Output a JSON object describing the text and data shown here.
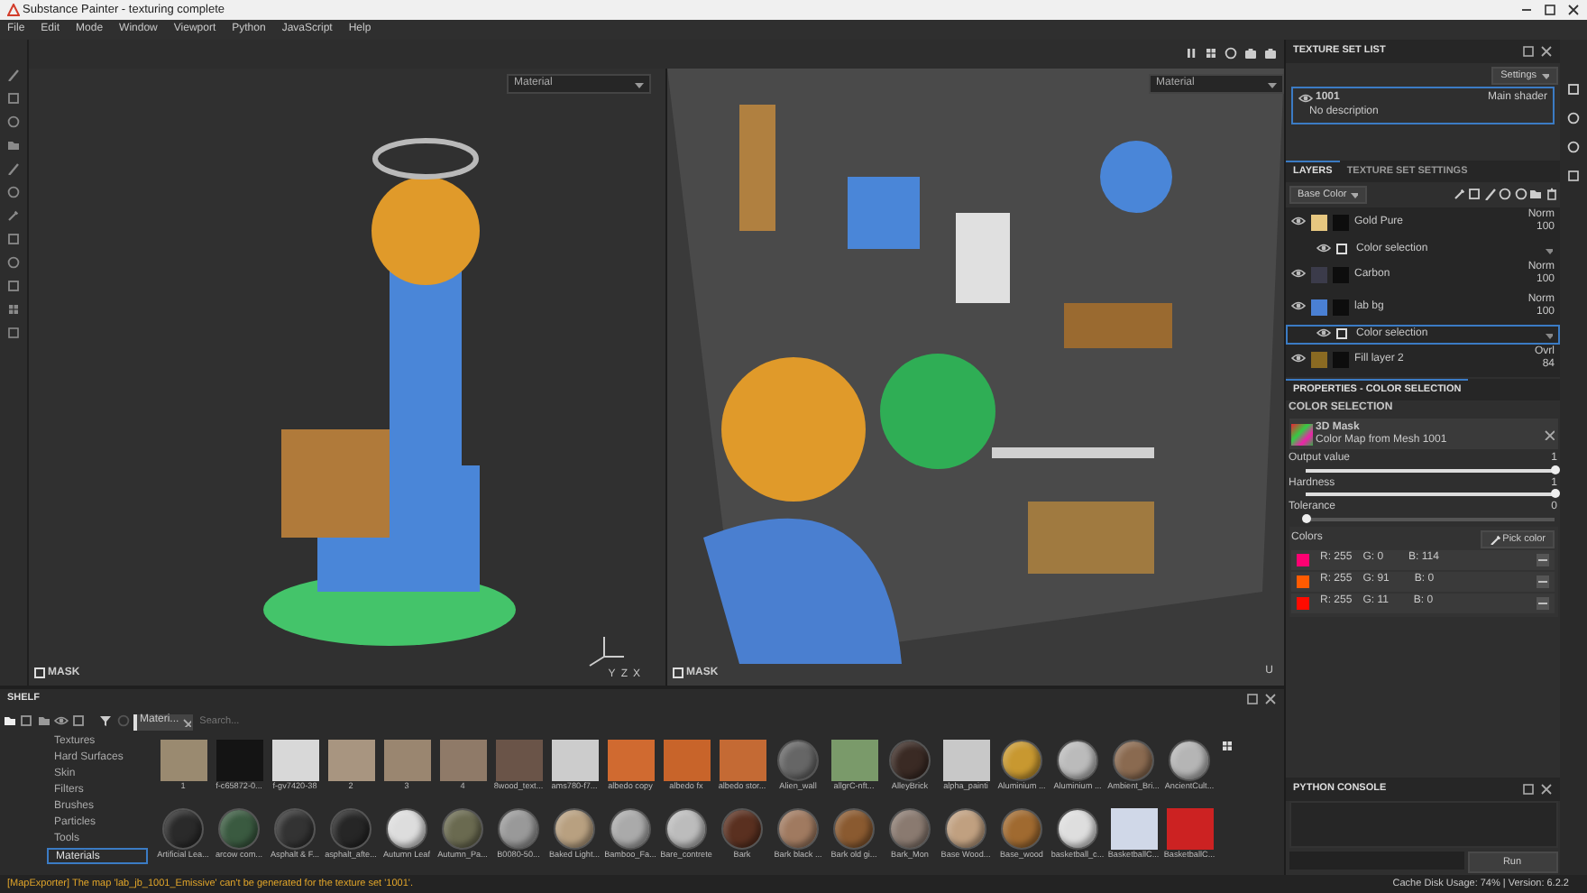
{
  "window": {
    "title": "Substance Painter - texturing complete"
  },
  "menu": [
    "File",
    "Edit",
    "Mode",
    "Window",
    "Viewport",
    "Python",
    "JavaScript",
    "Help"
  ],
  "viewport_3d": {
    "dropdown": "Material",
    "mask": {
      "label": "MASK",
      "checked": false
    },
    "axes": [
      "Y",
      "Z",
      "X"
    ]
  },
  "viewport_2d": {
    "dropdown": "Material",
    "mask": {
      "label": "MASK",
      "checked": false
    },
    "axes": [
      "U"
    ]
  },
  "texture_set_list": {
    "title": "TEXTURE SET LIST",
    "settings": "Settings",
    "items": [
      {
        "name": "1001",
        "description": "No description",
        "shader": "Main shader",
        "selected": true
      }
    ]
  },
  "layers": {
    "tabs": [
      {
        "label": "LAYERS",
        "selected": true
      },
      {
        "label": "TEXTURE SET SETTINGS",
        "selected": false
      }
    ],
    "channel": "Base Color",
    "items": [
      {
        "kind": "layer",
        "name": "Gold Pure",
        "blend": "Norm",
        "opacity": "100",
        "color": "#e6c780",
        "selected": false
      },
      {
        "kind": "effect",
        "name": "Color selection",
        "selected": false
      },
      {
        "kind": "layer",
        "name": "Carbon",
        "blend": "Norm",
        "opacity": "100",
        "color": "#3b3b4a",
        "selected": false
      },
      {
        "kind": "layer",
        "name": "lab bg",
        "blend": "Norm",
        "opacity": "100",
        "color": "#4a80d4",
        "selected": false
      },
      {
        "kind": "effect",
        "name": "Color selection",
        "selected": true
      },
      {
        "kind": "layer",
        "name": "Fill layer 2",
        "blend": "Ovrl",
        "opacity": "84",
        "color": "#8a6a22",
        "selected": false
      }
    ]
  },
  "properties": {
    "tab": "PROPERTIES - COLOR SELECTION",
    "section": "COLOR SELECTION",
    "mask": {
      "title": "3D Mask",
      "subtitle": "Color Map from Mesh 1001"
    },
    "sliders": [
      {
        "label": "Output value",
        "value": "1",
        "level": 1
      },
      {
        "label": "Hardness",
        "value": "1",
        "level": 1
      },
      {
        "label": "Tolerance",
        "value": "0",
        "level": 0
      }
    ],
    "colors_label": "Colors",
    "pick_button": "Pick color",
    "colors": [
      {
        "r": "R: 255",
        "g": "G: 0",
        "b": "B: 114",
        "color": "#ff0072"
      },
      {
        "r": "R: 255",
        "g": "G: 91",
        "b": "B: 0",
        "color": "#ff5b00"
      },
      {
        "r": "R: 255",
        "g": "G: 11",
        "b": "B: 0",
        "color": "#ff0b00"
      }
    ]
  },
  "python_console": {
    "title": "PYTHON CONSOLE",
    "run": "Run"
  },
  "shelf": {
    "title": "SHELF",
    "filter_chip": "Materi...",
    "search_placeholder": "Search...",
    "categories": [
      {
        "label": "Textures",
        "selected": false
      },
      {
        "label": "Hard Surfaces",
        "selected": false
      },
      {
        "label": "Skin",
        "selected": false
      },
      {
        "label": "Filters",
        "selected": false
      },
      {
        "label": "Brushes",
        "selected": false
      },
      {
        "label": "Particles",
        "selected": false
      },
      {
        "label": "Tools",
        "selected": false
      },
      {
        "label": "Materials",
        "selected": true
      }
    ],
    "assets": [
      {
        "label": "1",
        "kind": "flat",
        "color": "#9a8a70"
      },
      {
        "label": "f-c65872-0...",
        "kind": "flat",
        "color": "#141414"
      },
      {
        "label": "f-gv7420-38",
        "kind": "flat",
        "color": "#d8d8d8"
      },
      {
        "label": "2",
        "kind": "flat",
        "color": "#a89580"
      },
      {
        "label": "3",
        "kind": "flat",
        "color": "#9a8670"
      },
      {
        "label": "4",
        "kind": "flat",
        "color": "#8f7a68"
      },
      {
        "label": "8wood_text...",
        "kind": "flat",
        "color": "#6a5448"
      },
      {
        "label": "ams780-f7...",
        "kind": "flat",
        "color": "#cccccc"
      },
      {
        "label": "albedo copy",
        "kind": "flat",
        "color": "#d06a30"
      },
      {
        "label": "albedo fx",
        "kind": "flat",
        "color": "#c8642a"
      },
      {
        "label": "albedo stor...",
        "kind": "flat",
        "color": "#c46a34"
      },
      {
        "label": "Alien_wall",
        "kind": "sphere",
        "color": "#666666"
      },
      {
        "label": "allgrC-nft...",
        "kind": "flat",
        "color": "#7a9a6a"
      },
      {
        "label": "AlleyBrick",
        "kind": "sphere",
        "color": "#3a2a24"
      },
      {
        "label": "alpha_painti",
        "kind": "flat",
        "color": "#c8c8c8"
      },
      {
        "label": "Aluminium ...",
        "kind": "sphere",
        "color": "#c89830"
      },
      {
        "label": "Aluminium ...",
        "kind": "sphere",
        "color": "#bbbbbb"
      },
      {
        "label": "Ambient_Bri...",
        "kind": "sphere",
        "color": "#8a6a50"
      },
      {
        "label": "AncientCult...",
        "kind": "sphere",
        "color": "#b5b5b5"
      },
      {
        "label": "Artificial Lea...",
        "kind": "sphere",
        "color": "#2a2a2a"
      },
      {
        "label": "arcow com...",
        "kind": "sphere",
        "color": "#3a5a40"
      },
      {
        "label": "Asphalt & F...",
        "kind": "sphere",
        "color": "#333333"
      },
      {
        "label": "asphalt_afte...",
        "kind": "sphere",
        "color": "#262626"
      },
      {
        "label": "Autumn Leaf",
        "kind": "sphere",
        "color": "#dddddd"
      },
      {
        "label": "Autumn_Pa...",
        "kind": "sphere",
        "color": "#6a6a50"
      },
      {
        "label": "B0080-50...",
        "kind": "sphere",
        "color": "#999999"
      },
      {
        "label": "Baked Light...",
        "kind": "sphere",
        "color": "#b8a080"
      },
      {
        "label": "Bamboo_Fa...",
        "kind": "sphere",
        "color": "#aaaaaa"
      },
      {
        "label": "Bare_contrete",
        "kind": "sphere",
        "color": "#bcbcbc"
      },
      {
        "label": "Bark",
        "kind": "sphere",
        "color": "#5a3020"
      },
      {
        "label": "Bark black ...",
        "kind": "sphere",
        "color": "#a07a60"
      },
      {
        "label": "Bark old gi...",
        "kind": "sphere",
        "color": "#8a5a30"
      },
      {
        "label": "Bark_Mon",
        "kind": "sphere",
        "color": "#8a7a70"
      },
      {
        "label": "Base Wood...",
        "kind": "sphere",
        "color": "#c0a080"
      },
      {
        "label": "Base_wood",
        "kind": "sphere",
        "color": "#a06a30"
      },
      {
        "label": "basketball_c...",
        "kind": "sphere",
        "color": "#dedede"
      },
      {
        "label": "BasketballC...",
        "kind": "flat",
        "color": "#d0d8e8"
      },
      {
        "label": "BasketballC...",
        "kind": "flat",
        "color": "#cc2222"
      }
    ]
  },
  "status_bar": {
    "message": "[MapExporter] The map 'lab_jb_1001_Emissive' can't be generated for the texture set '1001'.",
    "cache": "Cache Disk Usage:",
    "usage": "74% | Version: 6.2.2"
  }
}
